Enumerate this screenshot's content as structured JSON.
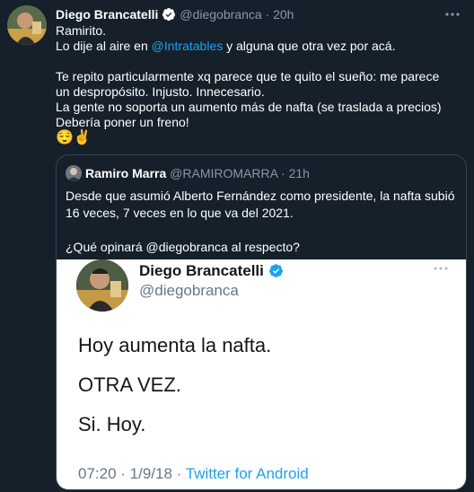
{
  "tweet": {
    "author_name": "Diego Brancatelli",
    "author_handle": "@diegobranca",
    "separator": "·",
    "time": "20h",
    "body": {
      "line1": "Ramirito.",
      "line2_prefix": "Lo dije al aire en ",
      "mention": "@Intratables",
      "line2_suffix": " y alguna que otra vez por acá.",
      "line3": "Te repito particularmente xq parece que te quito el sueño: me parece un despropósito. Injusto. Innecesario.",
      "line4": "La gente no soporta un aumento más de nafta (se traslada a precios) Debería poner un freno!",
      "emojis": "😌✌️"
    }
  },
  "quoted": {
    "author_name": "Ramiro Marra",
    "author_handle": "@RAMIROMARRA",
    "separator": "·",
    "time": "21h",
    "text1": "Desde que asumió Alberto Fernández como presidente, la nafta subió 16 veces, 7 veces en lo que va del 2021.",
    "text2": "¿Qué opinará @diegobranca al respecto?"
  },
  "screenshot": {
    "author_name": "Diego Brancatelli",
    "author_handle": "@diegobranca",
    "line1": "Hoy aumenta la nafta.",
    "line2": "OTRA VEZ.",
    "line3": "Si. Hoy.",
    "timestamp": "07:20 · 1/9/18 · ",
    "source": "Twitter for Android"
  },
  "colors": {
    "background": "#15202b",
    "link": "#1da1f2",
    "muted": "#8899a6",
    "border": "#38444d"
  },
  "icons": [
    "verified-badge-icon",
    "more-options-icon"
  ]
}
